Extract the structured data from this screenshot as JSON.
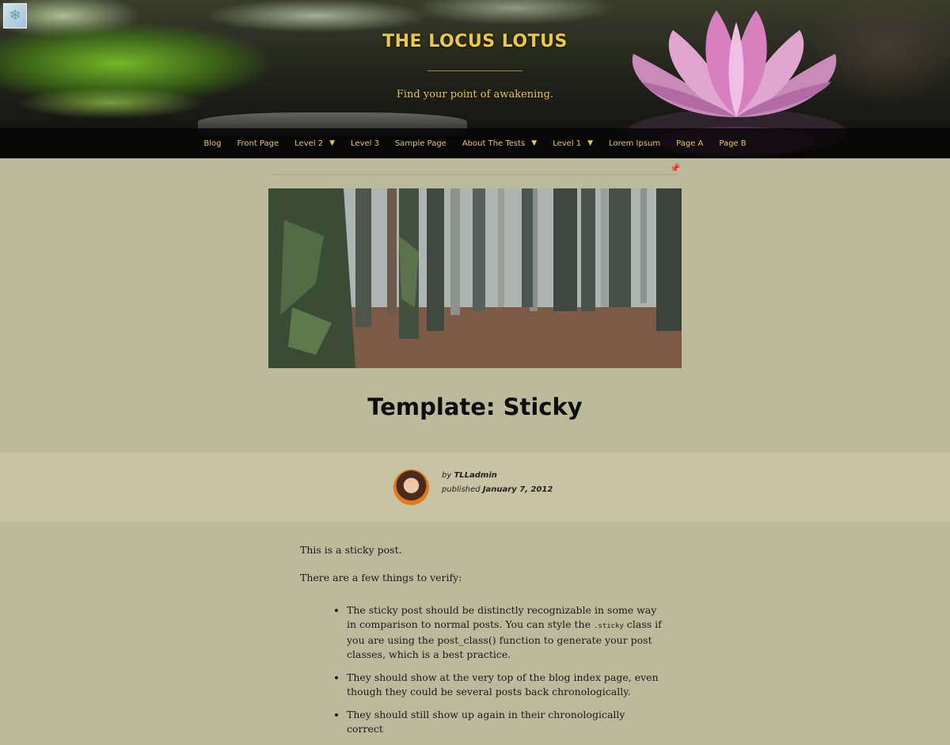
{
  "header": {
    "site_title": "THE LOCUS LOTUS",
    "tagline": "Find your point of awakening."
  },
  "nav": {
    "items": [
      {
        "label": "Blog",
        "has_submenu": false
      },
      {
        "label": "Front Page",
        "has_submenu": false
      },
      {
        "label": "Level 2",
        "has_submenu": true
      },
      {
        "label": "Level 3",
        "has_submenu": false
      },
      {
        "label": "Sample Page",
        "has_submenu": false
      },
      {
        "label": "About The Tests",
        "has_submenu": true
      },
      {
        "label": "Level 1",
        "has_submenu": true
      },
      {
        "label": "Lorem Ipsum",
        "has_submenu": false
      },
      {
        "label": "Page A",
        "has_submenu": false
      },
      {
        "label": "Page B",
        "has_submenu": false
      }
    ]
  },
  "post": {
    "title": "Template: Sticky",
    "author_prefix": "by",
    "author": "TLLadmin",
    "published_prefix": "published",
    "date": "January 7, 2012",
    "intro": "This is a sticky post.",
    "verify_lead": "There are a few things to verify:",
    "bullet1_a": "The sticky post should be distinctly recognizable in some way in comparison to normal posts. You can style the ",
    "bullet1_code": ".sticky",
    "bullet1_b": " class if you are using the post_class() function to generate your post classes, which is a best practice.",
    "bullet2": "They should show at the very top of the blog index page, even though they could be several posts back chronologically.",
    "bullet3": "They should still show up again in their chronologically correct"
  },
  "icons": {
    "badge": "snowflake-icon",
    "sticky": "pushpin-icon",
    "submenu": "chevron-down-icon"
  },
  "colors": {
    "accent": "#e8c74a",
    "background": "#bbba9a",
    "meta_band": "#c8c3a3",
    "nav_bg": "#0a0a0a"
  }
}
